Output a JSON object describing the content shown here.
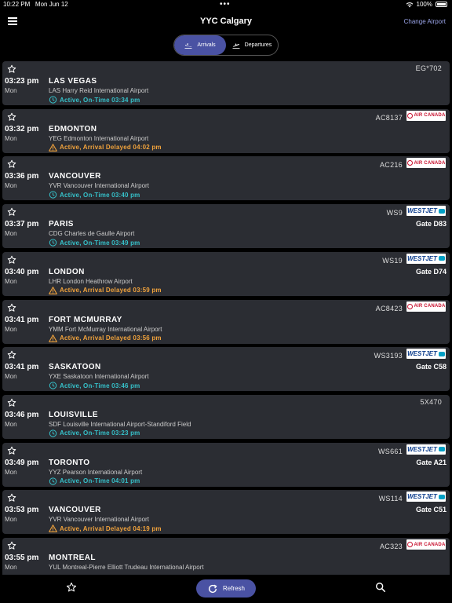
{
  "status_bar": {
    "time": "10:22 PM",
    "date": "Mon Jun 12",
    "battery": "100%"
  },
  "header": {
    "title": "YYC Calgary",
    "change_airport": "Change Airport"
  },
  "segments": {
    "arrivals": "Arrivals",
    "departures": "Departures"
  },
  "colors": {
    "accent": "#4a52a3",
    "on_time": "#36c0c9",
    "delayed": "#f0a23c",
    "card_bg": "#2b2d33"
  },
  "flights": [
    {
      "flight": "EG*702",
      "logo": "",
      "time": "03:23 pm",
      "day": "Mon",
      "city": "LAS VEGAS",
      "airport": "LAS Harry Reid International Airport",
      "gate": "",
      "status": "Active, On-Time 03:34 pm",
      "status_type": "ok"
    },
    {
      "flight": "AC8137",
      "logo": "AIR CANADA",
      "time": "03:32 pm",
      "day": "Mon",
      "city": "EDMONTON",
      "airport": "YEG Edmonton International Airport",
      "gate": "",
      "status": "Active, Arrival Delayed 04:02 pm",
      "status_type": "delay"
    },
    {
      "flight": "AC216",
      "logo": "AIR CANADA",
      "time": "03:36 pm",
      "day": "Mon",
      "city": "VANCOUVER",
      "airport": "YVR Vancouver International Airport",
      "gate": "",
      "status": "Active, On-Time 03:40 pm",
      "status_type": "ok"
    },
    {
      "flight": "WS9",
      "logo": "WESTJET",
      "time": "03:37 pm",
      "day": "Mon",
      "city": "PARIS",
      "airport": "CDG Charles de Gaulle Airport",
      "gate": "Gate D83",
      "status": "Active, On-Time 03:49 pm",
      "status_type": "ok"
    },
    {
      "flight": "WS19",
      "logo": "WESTJET",
      "time": "03:40 pm",
      "day": "Mon",
      "city": "LONDON",
      "airport": "LHR London Heathrow Airport",
      "gate": "Gate D74",
      "status": "Active, Arrival Delayed 03:59 pm",
      "status_type": "delay"
    },
    {
      "flight": "AC8423",
      "logo": "AIR CANADA",
      "time": "03:41 pm",
      "day": "Mon",
      "city": "FORT MCMURRAY",
      "airport": "YMM Fort McMurray International Airport",
      "gate": "",
      "status": "Active, Arrival Delayed 03:56 pm",
      "status_type": "delay"
    },
    {
      "flight": "WS3193",
      "logo": "WESTJET",
      "time": "03:41 pm",
      "day": "Mon",
      "city": "SASKATOON",
      "airport": "YXE Saskatoon International Airport",
      "gate": "Gate C58",
      "status": "Active, On-Time 03:46 pm",
      "status_type": "ok"
    },
    {
      "flight": "5X470",
      "logo": "",
      "time": "03:46 pm",
      "day": "Mon",
      "city": "LOUISVILLE",
      "airport": "SDF Louisville International Airport-Standiford Field",
      "gate": "",
      "status": "Active, On-Time 03:23 pm",
      "status_type": "ok"
    },
    {
      "flight": "WS661",
      "logo": "WESTJET",
      "time": "03:49 pm",
      "day": "Mon",
      "city": "TORONTO",
      "airport": "YYZ Pearson International Airport",
      "gate": "Gate A21",
      "status": "Active, On-Time 04:01 pm",
      "status_type": "ok"
    },
    {
      "flight": "WS114",
      "logo": "WESTJET",
      "time": "03:53 pm",
      "day": "Mon",
      "city": "VANCOUVER",
      "airport": "YVR Vancouver International Airport",
      "gate": "Gate C51",
      "status": "Active, Arrival Delayed 04:19 pm",
      "status_type": "delay"
    },
    {
      "flight": "AC323",
      "logo": "AIR CANADA",
      "time": "03:55 pm",
      "day": "Mon",
      "city": "MONTREAL",
      "airport": "YUL Montreal-Pierre Elliott Trudeau International Airport",
      "gate": "",
      "status": "",
      "status_type": "ok"
    }
  ],
  "tabbar": {
    "refresh": "Refresh"
  }
}
